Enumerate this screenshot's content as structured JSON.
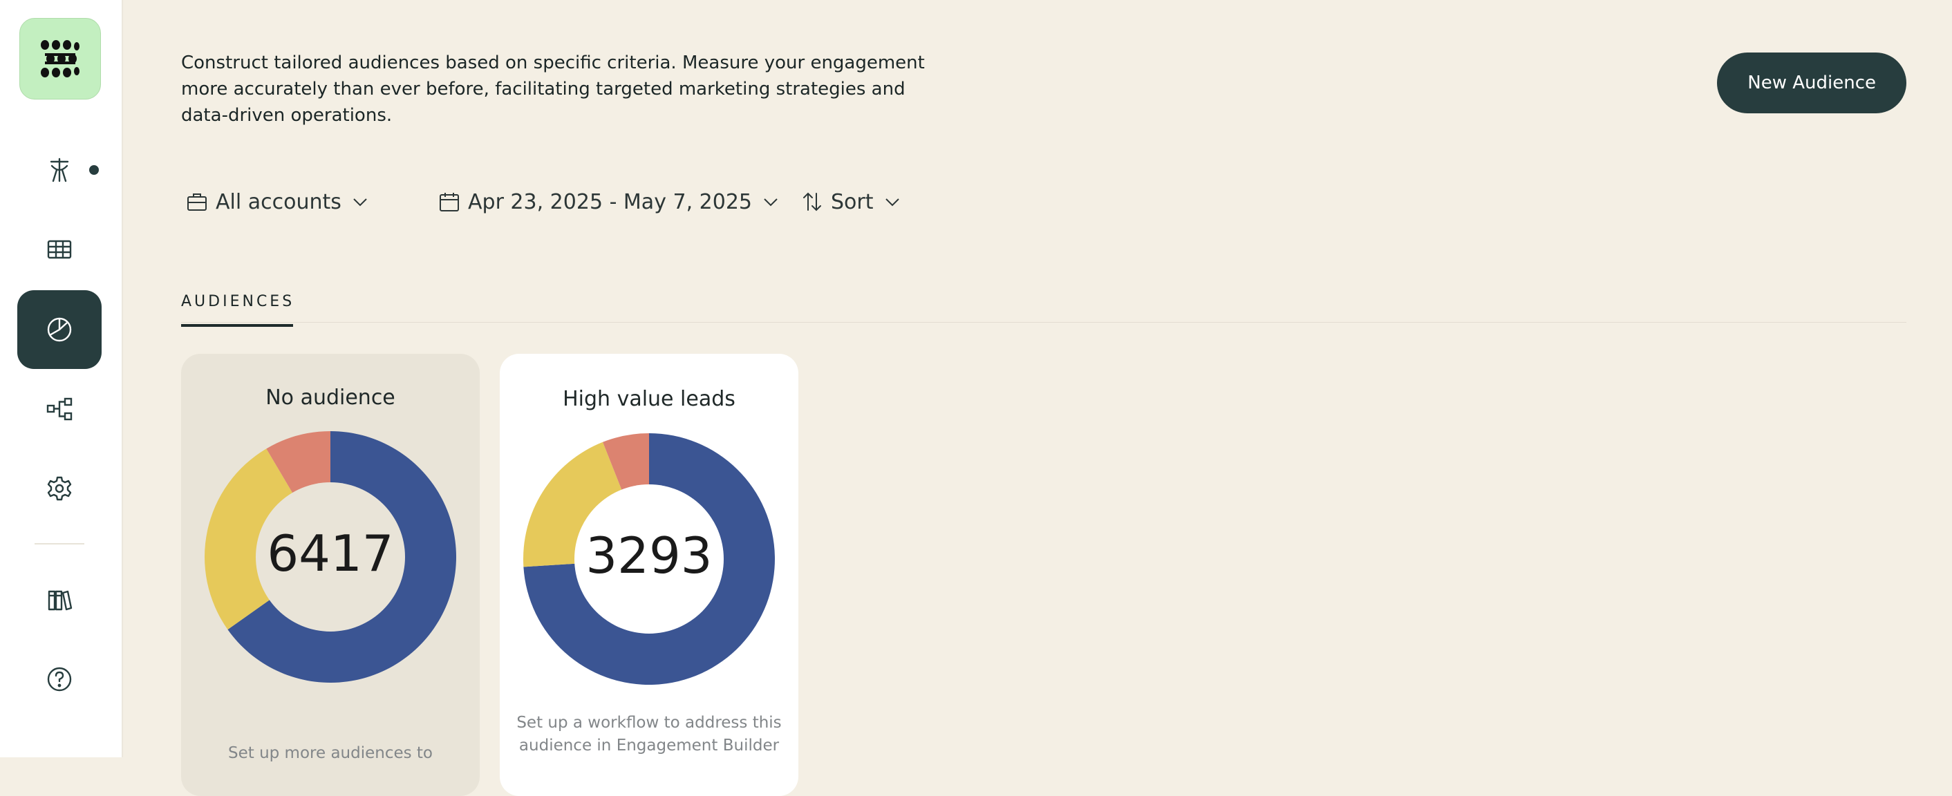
{
  "sidebar": {
    "items": [
      {
        "name": "nav-item-signals",
        "icon": "antenna-icon"
      },
      {
        "name": "nav-item-tables",
        "icon": "table-icon"
      },
      {
        "name": "nav-item-audiences",
        "icon": "pie-chart-icon",
        "active": true
      },
      {
        "name": "nav-item-workflows",
        "icon": "workflow-icon"
      },
      {
        "name": "nav-item-settings",
        "icon": "gear-icon"
      },
      {
        "name": "nav-item-library",
        "icon": "books-icon"
      },
      {
        "name": "nav-item-help",
        "icon": "help-icon"
      }
    ]
  },
  "header": {
    "description": "Construct tailored audiences based on specific criteria. Measure your engagement more accurately than ever before, facilitating targeted marketing strategies and data-driven operations.",
    "new_button": "New Audience"
  },
  "filters": {
    "accounts": "All accounts",
    "date_range": "Apr 23, 2025 - May 7, 2025",
    "sort": "Sort"
  },
  "tabs": {
    "audiences": "AUDIENCES"
  },
  "colors": {
    "blue": "#3b5593",
    "yellow": "#e6c95a",
    "salmon": "#dc8370",
    "accent": "#273d3e"
  },
  "cards": [
    {
      "title": "No audience",
      "count": "6417",
      "segments": [
        0.652,
        0.263,
        0.085
      ],
      "note": "Set up more audiences to"
    },
    {
      "title": "High value leads",
      "count": "3293",
      "segments": [
        0.74,
        0.2,
        0.06
      ],
      "note": "Set up a workflow to address this audience in Engagement Builder"
    }
  ]
}
